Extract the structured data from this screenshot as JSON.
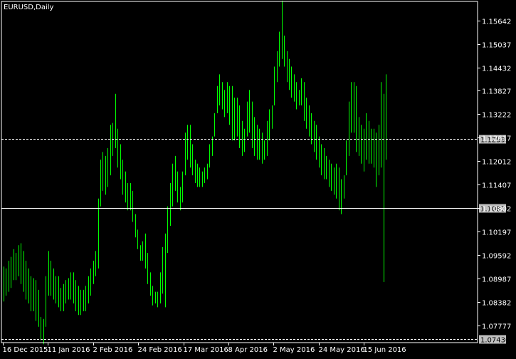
{
  "chart_title": "EURUSD,Daily",
  "colors": {
    "background": "#000000",
    "bar": "#00ff00",
    "frame": "#ffffff",
    "text": "#ffffff",
    "hline": "#ffffff",
    "price_label_bg": "#c0c0c0",
    "price_label_text": "#000000"
  },
  "chart_data": {
    "type": "ohlc",
    "symbol": "EURUSD",
    "timeframe": "Daily",
    "y_ticks": [
      "1.15642",
      "1.15037",
      "1.14432",
      "1.13827",
      "1.13222",
      "1.12617",
      "1.12012",
      "1.11407",
      "1.10802",
      "1.10197",
      "1.09592",
      "1.08987",
      "1.08382",
      "1.07777"
    ],
    "x_ticks": [
      "16 Dec 2015",
      "11 Jan 2016",
      "2 Feb 2016",
      "24 Feb 2016",
      "17 Mar 2016",
      "8 Apr 2016",
      "2 May 2016",
      "24 May 2016",
      "15 Jun 2016"
    ],
    "ylim": [
      1.0734,
      1.1613
    ],
    "reference_lines": [
      {
        "value": 1.12595,
        "label": "1.12595",
        "style": "dashed"
      },
      {
        "value": 1.10812,
        "label": "1.10812",
        "style": "solid"
      },
      {
        "value": 1.0743,
        "label": "1.07430",
        "style": "dashed"
      }
    ],
    "highs": [
      1.093,
      1.0925,
      1.0945,
      1.0955,
      1.0975,
      1.0965,
      1.0985,
      1.099,
      1.097,
      1.0945,
      1.0925,
      1.0905,
      1.09,
      1.0895,
      1.087,
      1.08,
      1.0795,
      1.0905,
      1.097,
      1.0945,
      1.0925,
      1.0905,
      1.0905,
      1.0875,
      1.0885,
      1.0895,
      1.09,
      1.0915,
      1.0915,
      1.0895,
      1.088,
      1.087,
      1.087,
      1.088,
      1.0905,
      1.0925,
      1.0945,
      1.097,
      1.1105,
      1.1205,
      1.1225,
      1.1215,
      1.1235,
      1.1295,
      1.13,
      1.1375,
      1.1285,
      1.1245,
      1.1205,
      1.1175,
      1.1145,
      1.1145,
      1.1125,
      1.1065,
      1.1025,
      1.0985,
      1.0995,
      1.1015,
      1.0965,
      1.0915,
      1.088,
      1.0865,
      1.0865,
      1.0915,
      1.098,
      1.1015,
      1.1085,
      1.1145,
      1.1195,
      1.1215,
      1.1175,
      1.1135,
      1.1175,
      1.1275,
      1.1295,
      1.1295,
      1.1245,
      1.1205,
      1.1195,
      1.1185,
      1.1175,
      1.1185,
      1.1195,
      1.1245,
      1.1265,
      1.1325,
      1.1395,
      1.1425,
      1.1405,
      1.1385,
      1.1405,
      1.1395,
      1.1395,
      1.1365,
      1.1365,
      1.1345,
      1.1305,
      1.1285,
      1.1355,
      1.1385,
      1.1355,
      1.1315,
      1.1295,
      1.1285,
      1.1275,
      1.1255,
      1.1305,
      1.1335,
      1.1345,
      1.1445,
      1.1485,
      1.1535,
      1.1615,
      1.1525,
      1.1485,
      1.1465,
      1.1445,
      1.1425,
      1.1405,
      1.1385,
      1.1415,
      1.1405,
      1.1365,
      1.1345,
      1.1325,
      1.1305,
      1.1295,
      1.1265,
      1.1245,
      1.1235,
      1.1215,
      1.1205,
      1.1195,
      1.1185,
      1.1195,
      1.1185,
      1.1155,
      1.1165,
      1.1255,
      1.1355,
      1.1405,
      1.1405,
      1.1395,
      1.1315,
      1.1295,
      1.1285,
      1.1325,
      1.1305,
      1.1285,
      1.1285,
      1.1275,
      1.1295,
      1.1405,
      1.1375,
      1.1425
    ],
    "lows": [
      1.084,
      1.0855,
      1.0865,
      1.0875,
      1.0895,
      1.0895,
      1.0905,
      1.0885,
      1.0865,
      1.0845,
      1.0835,
      1.0815,
      1.0815,
      1.079,
      1.0775,
      1.074,
      1.073,
      1.0775,
      1.0855,
      1.0855,
      1.0845,
      1.0835,
      1.0825,
      1.0815,
      1.0815,
      1.0835,
      1.0845,
      1.0845,
      1.0835,
      1.0815,
      1.0805,
      1.0805,
      1.0815,
      1.0815,
      1.0835,
      1.0855,
      1.0885,
      1.0905,
      1.0925,
      1.1085,
      1.1125,
      1.1115,
      1.1135,
      1.1165,
      1.1215,
      1.1235,
      1.1185,
      1.1155,
      1.1115,
      1.1095,
      1.1075,
      1.1075,
      1.1045,
      1.1005,
      1.0975,
      1.0945,
      1.0945,
      1.0925,
      1.0885,
      1.0855,
      1.083,
      1.0835,
      1.0825,
      1.0835,
      1.086,
      1.0825,
      1.0965,
      1.1035,
      1.1085,
      1.1125,
      1.1095,
      1.1075,
      1.1095,
      1.1165,
      1.1205,
      1.1185,
      1.1165,
      1.1145,
      1.1135,
      1.1135,
      1.1135,
      1.1145,
      1.1155,
      1.1185,
      1.1215,
      1.1265,
      1.1325,
      1.1345,
      1.1335,
      1.1315,
      1.1325,
      1.1295,
      1.1255,
      1.1255,
      1.1265,
      1.1235,
      1.1215,
      1.1225,
      1.1265,
      1.1275,
      1.1235,
      1.1215,
      1.1205,
      1.1205,
      1.1195,
      1.1205,
      1.1215,
      1.1255,
      1.1285,
      1.1345,
      1.1405,
      1.1445,
      1.1465,
      1.1445,
      1.1405,
      1.1385,
      1.1365,
      1.1355,
      1.1335,
      1.1345,
      1.1345,
      1.1305,
      1.1285,
      1.1265,
      1.1245,
      1.1225,
      1.1205,
      1.1185,
      1.1165,
      1.1155,
      1.1155,
      1.1135,
      1.1125,
      1.1115,
      1.1105,
      1.1075,
      1.1065,
      1.1105,
      1.1165,
      1.1215,
      1.1275,
      1.1275,
      1.1225,
      1.1215,
      1.1195,
      1.1175,
      1.1205,
      1.1195,
      1.1195,
      1.1185,
      1.1135,
      1.1165,
      1.1185,
      1.089,
      1.1205
    ]
  }
}
